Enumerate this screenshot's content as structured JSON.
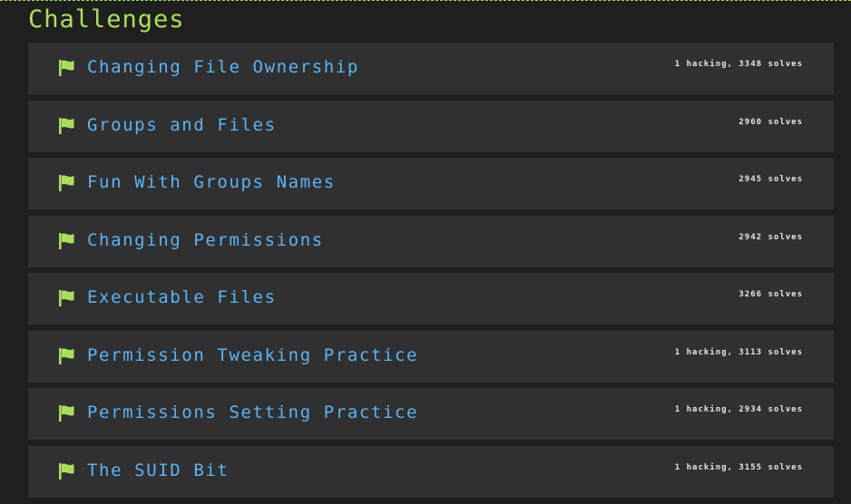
{
  "page": {
    "title": "Challenges",
    "accent_color": "#a8e05c",
    "link_color": "#58b4f5"
  },
  "challenges": [
    {
      "name": "Changing File Ownership",
      "stats": "1 hacking, 3348 solves",
      "icon": "flag-icon"
    },
    {
      "name": "Groups and Files",
      "stats": "2960 solves",
      "icon": "flag-icon"
    },
    {
      "name": "Fun With Groups Names",
      "stats": "2945 solves",
      "icon": "flag-icon"
    },
    {
      "name": "Changing Permissions",
      "stats": "2942 solves",
      "icon": "flag-icon"
    },
    {
      "name": "Executable Files",
      "stats": "3266 solves",
      "icon": "flag-icon"
    },
    {
      "name": "Permission Tweaking Practice",
      "stats": "1 hacking, 3113 solves",
      "icon": "flag-icon"
    },
    {
      "name": "Permissions Setting Practice",
      "stats": "1 hacking, 2934 solves",
      "icon": "flag-icon"
    },
    {
      "name": "The SUID Bit",
      "stats": "1 hacking, 3155 solves",
      "icon": "flag-icon"
    }
  ]
}
